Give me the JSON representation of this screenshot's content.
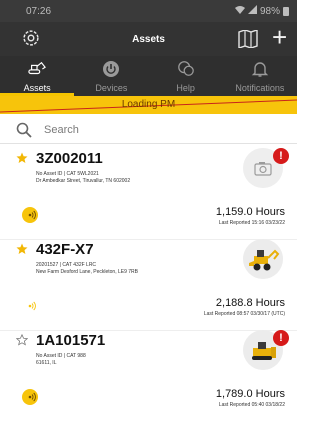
{
  "status": {
    "time": "07:26",
    "battery": "98%"
  },
  "appbar": {
    "title": "Assets"
  },
  "tabs": [
    {
      "label": "Assets",
      "icon": "excavator-icon",
      "active": true
    },
    {
      "label": "Devices",
      "icon": "power-icon",
      "active": false
    },
    {
      "label": "Help",
      "icon": "chat-bubbles-icon",
      "active": false
    },
    {
      "label": "Notifications",
      "icon": "bell-icon",
      "active": false
    }
  ],
  "banner": {
    "text": "Loading PM"
  },
  "search": {
    "placeholder": "Search",
    "value": ""
  },
  "assets": [
    {
      "name": "3Z002011",
      "line1": "No Asset ID | CAT 5WL2021",
      "line2": "Dr Ambedkar Street, Tiruvallur, TN 602002",
      "favorite": true,
      "image": "camera-placeholder",
      "alert": "!",
      "hours": "1,159.0 Hours",
      "reported": "Last Reported 15:16 03/23/22"
    },
    {
      "name": "432F-X7",
      "line1": "20201527 | CAT 432F LRC",
      "line2": "New Farm Desford Lane, Peckleton, LE9 7RB",
      "favorite": true,
      "image": "backhoe-loader",
      "alert": "",
      "hours": "2,188.8 Hours",
      "reported": "Last Reported 08:57 03/30/17 (UTC)"
    },
    {
      "name": "1A101571",
      "line1": "No Asset ID | CAT 988",
      "line2": "61611, IL",
      "favorite": false,
      "image": "dozer",
      "alert": "!",
      "hours": "1,789.0 Hours",
      "reported": "Last Reported 05:40 03/18/22"
    }
  ],
  "colors": {
    "accent": "#f7c40b",
    "alert": "#d61a1a",
    "appbar": "#333333",
    "tabbar": "#2f2f2f"
  }
}
